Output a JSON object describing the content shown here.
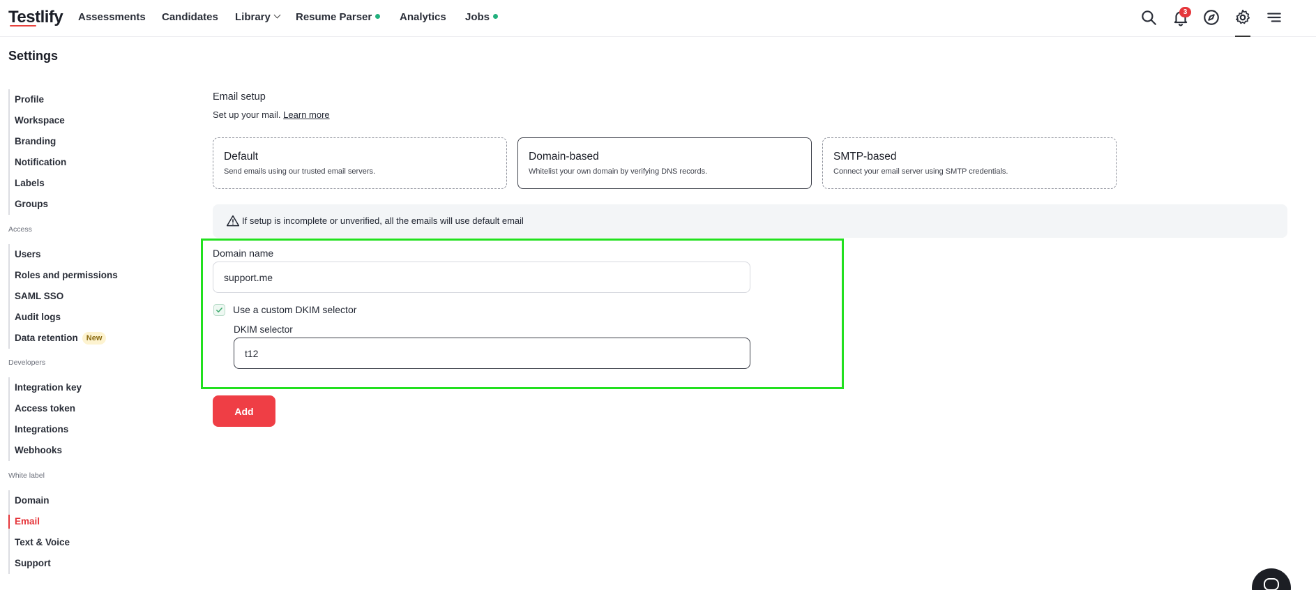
{
  "app": {
    "logo": "Testlify"
  },
  "nav": {
    "assessments": "Assessments",
    "candidates": "Candidates",
    "library": "Library",
    "resume_parser": "Resume Parser",
    "analytics": "Analytics",
    "jobs": "Jobs",
    "notification_count": "3"
  },
  "page": {
    "title": "Settings"
  },
  "sidebar": {
    "general": [
      "Profile",
      "Workspace",
      "Branding",
      "Notification",
      "Labels",
      "Groups"
    ],
    "access_heading": "Access",
    "access": [
      "Users",
      "Roles and permissions",
      "SAML SSO",
      "Audit logs",
      "Data retention"
    ],
    "new_badge": "New",
    "developers_heading": "Developers",
    "developers": [
      "Integration key",
      "Access token",
      "Integrations",
      "Webhooks"
    ],
    "white_label_heading": "White label",
    "white_label": [
      "Domain",
      "Email",
      "Text & Voice",
      "Support"
    ],
    "active_item": "Email"
  },
  "email_setup": {
    "title": "Email setup",
    "subtitle": "Set up your mail.",
    "learn_more": "Learn more",
    "options": [
      {
        "title": "Default",
        "desc": "Send emails using our trusted email servers."
      },
      {
        "title": "Domain-based",
        "desc": "Whitelist your own domain by verifying DNS records."
      },
      {
        "title": "SMTP-based",
        "desc": "Connect your email server using SMTP credentials."
      }
    ],
    "selected_option": "Domain-based",
    "notice": "If setup is incomplete or unverified, all the emails will use default email"
  },
  "form": {
    "domain_label": "Domain name",
    "domain_value": "support.me",
    "custom_dkim_label": "Use a custom DKIM selector",
    "custom_dkim_checked": true,
    "dkim_label": "DKIM selector",
    "dkim_value": "t12",
    "add_label": "Add"
  },
  "colors": {
    "accent": "#ef3e45",
    "highlight": "#22e01f",
    "success_dot": "#22b07d"
  }
}
